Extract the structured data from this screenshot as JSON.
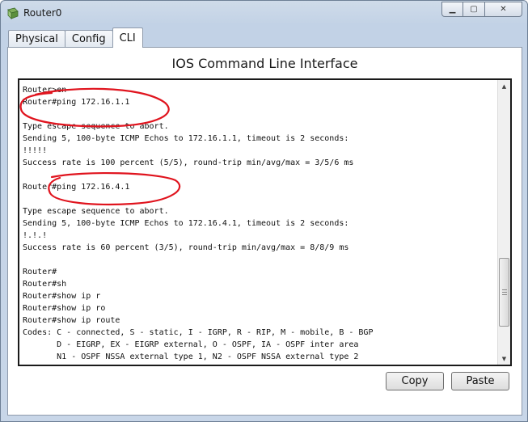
{
  "window": {
    "title": "Router0",
    "icon": "router-app-icon"
  },
  "controls": {
    "minimize": "▁",
    "maximize": "▢",
    "close": "✕"
  },
  "tabs": [
    {
      "label": "Physical",
      "active": false
    },
    {
      "label": "Config",
      "active": false
    },
    {
      "label": "CLI",
      "active": true
    }
  ],
  "heading": "IOS Command Line Interface",
  "terminal": {
    "lines": [
      "Router>",
      "Router>en",
      "Router#ping 172.16.1.1",
      "",
      "Type escape sequence to abort.",
      "Sending 5, 100-byte ICMP Echos to 172.16.1.1, timeout is 2 seconds:",
      "!!!!!",
      "Success rate is 100 percent (5/5), round-trip min/avg/max = 3/5/6 ms",
      "",
      "Router#ping 172.16.4.1",
      "",
      "Type escape sequence to abort.",
      "Sending 5, 100-byte ICMP Echos to 172.16.4.1, timeout is 2 seconds:",
      "!.!.!",
      "Success rate is 60 percent (3/5), round-trip min/avg/max = 8/8/9 ms",
      "",
      "Router#",
      "Router#sh",
      "Router#show ip r",
      "Router#show ip ro",
      "Router#show ip route",
      "Codes: C - connected, S - static, I - IGRP, R - RIP, M - mobile, B - BGP",
      "       D - EIGRP, EX - EIGRP external, O - OSPF, IA - OSPF inter area",
      "       N1 - OSPF NSSA external type 1, N2 - OSPF NSSA external type 2"
    ]
  },
  "buttons": {
    "copy": "Copy",
    "paste": "Paste"
  },
  "colors": {
    "annotation": "#e0141e"
  }
}
